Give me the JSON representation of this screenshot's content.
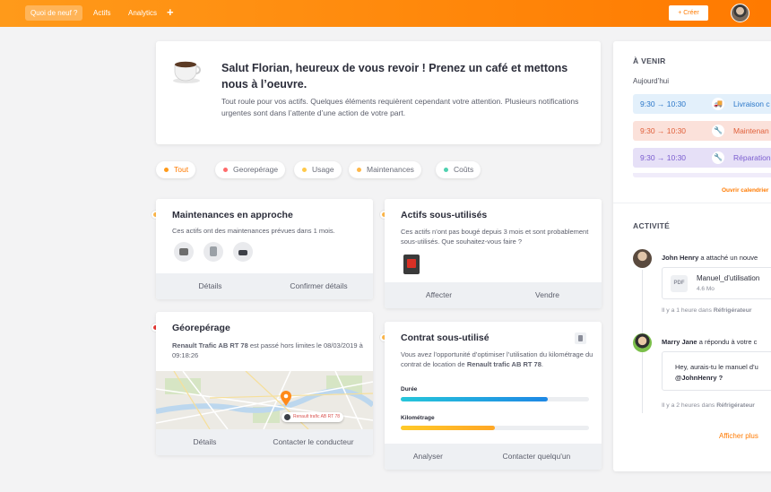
{
  "topbar": {
    "nav": [
      "Quoi de neuf ?",
      "Actifs",
      "Analytics"
    ],
    "plus": "+",
    "create_label": "+ Créer"
  },
  "welcome": {
    "title": "Salut Florian, heureux de vous revoir ! Prenez un café et mettons nous à l’oeuvre.",
    "text": "Tout roule pour vos actifs. Quelques éléments requièrent cependant votre attention. Plusieurs notifications urgentes sont dans l’attente d’une action de votre part."
  },
  "filters": [
    {
      "label": "Tout",
      "color": "#ff9a1a"
    },
    {
      "label": "Georepérage",
      "color": "#ff6b6b"
    },
    {
      "label": "Usage",
      "color": "#ffc94a"
    },
    {
      "label": "Maintenances",
      "color": "#ffb84a"
    },
    {
      "label": "Coûts",
      "color": "#4fd1b0"
    }
  ],
  "cards": {
    "maintenances": {
      "title": "Maintenances en approche",
      "text": "Ces actifs ont des maintenances prévues dans 1 mois.",
      "actions": [
        "Détails",
        "Confirmer détails"
      ]
    },
    "sous_utilises": {
      "title": "Actifs sous-utilisés",
      "text": "Ces actifs n’ont pas bougé depuis 3 mois et sont probablement sous-utilisés. Que souhaitez-vous faire ?",
      "actions": [
        "Affecter",
        "Vendre"
      ]
    },
    "georeperage": {
      "title": "Géorepérage",
      "text_strong": "Renault Trafic AB RT 78",
      "text_rest": " est passé hors limites le 08/03/2019 à 09:18:26",
      "map_tag": "Renault trafic AB RT 78",
      "actions": [
        "Détails",
        "Contacter le conducteur"
      ]
    },
    "contrat": {
      "title": "Contrat sous-utilisé",
      "text_pre": "Vous avez l’opportunité d’optimiser l’utilisation du kilométrage du contrat de location de ",
      "text_strong": "Renault trafic AB RT 78",
      "text_post": ".",
      "bars": [
        {
          "label": "Durée",
          "value": 0.78,
          "color": "#1e88e5"
        },
        {
          "label": "Kilométrage",
          "value": 0.5,
          "color": "#ffa726"
        }
      ],
      "actions": [
        "Analyser",
        "Contacter quelqu'un"
      ]
    }
  },
  "upcoming": {
    "heading": "À VENIR",
    "day": "Aujourd’hui",
    "events": [
      {
        "time": "9:30 → 10:30",
        "label": "Livraison c",
        "bg": "#e3f0fb",
        "fg": "#2b77c9"
      },
      {
        "time": "9:30 → 10:30",
        "label": "Maintenan",
        "bg": "#fbe1da",
        "fg": "#e0603b"
      },
      {
        "time": "9:30 → 10:30",
        "label": "Réparation",
        "bg": "#e6e0f7",
        "fg": "#7a5ccf"
      }
    ],
    "open_calendar": "Ouvrir calendrier"
  },
  "activity": {
    "heading": "ACTIVITÉ",
    "items": [
      {
        "user": "John Henry",
        "action": " a attaché un nouve",
        "file_name": "Manuel_d’utilisation",
        "file_size": "4.6 Mo",
        "file_type": "PDF",
        "meta_pre": "Il y a 1 heure dans ",
        "meta_place": "Réfrigérateur"
      },
      {
        "user": "Marry Jane",
        "action": " a répondu à votre c",
        "reply": "Hey, aurais-tu le manuel d’u",
        "mention": "@JohnHenry ?",
        "meta_pre": "Il y a 2 heures dans ",
        "meta_place": "Réfrigérateur"
      }
    ],
    "show_more": "Afficher plus"
  }
}
